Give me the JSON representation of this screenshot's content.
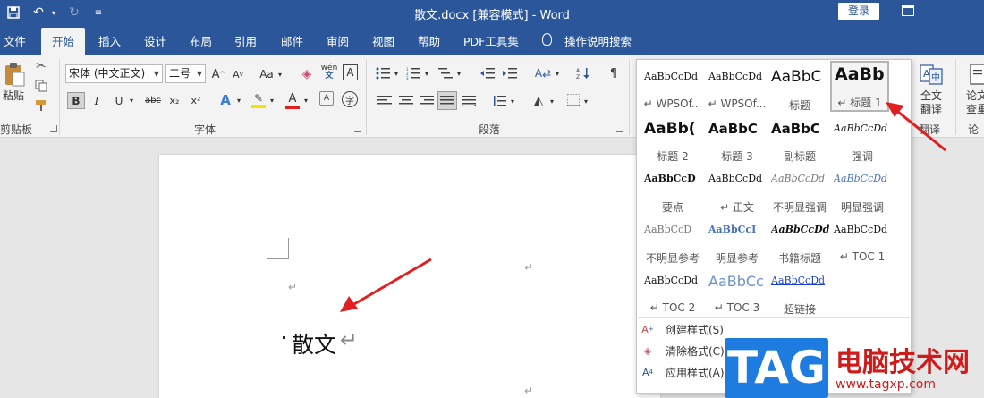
{
  "window": {
    "title": "散文.docx [兼容模式] - Word",
    "login_label": "登录"
  },
  "tabs": [
    "文件",
    "开始",
    "插入",
    "设计",
    "布局",
    "引用",
    "邮件",
    "审阅",
    "视图",
    "帮助",
    "PDF工具集",
    "操作说明搜索"
  ],
  "active_tab": "开始",
  "clipboard": {
    "paste_label": "粘贴",
    "group_label": "剪贴板"
  },
  "font": {
    "family": "宋体 (中文正文)",
    "size": "二号",
    "change_case": "Aa",
    "pinyin": "wén",
    "group_label": "字体",
    "bold": "B",
    "italic": "I",
    "underline": "U",
    "strike": "abc",
    "subscript": "x₂",
    "superscript": "x²",
    "char_border": "A",
    "font_color": "A",
    "font_color_hex": "#e02020",
    "highlight_hex": "#f5e200",
    "enclose": "字"
  },
  "paragraph": {
    "group_label": "段落"
  },
  "right_groups": {
    "translate_line1": "全文",
    "translate_line2": "翻译",
    "translate_group": "翻译",
    "paper_line1": "论文",
    "paper_line2": "查重",
    "paper_group": "论文"
  },
  "document": {
    "heading": "散文",
    "pilcrow": "↵"
  },
  "styles_gallery": {
    "items": [
      {
        "preview": "AaBbCcDd",
        "name": "↵ WPSOf..."
      },
      {
        "preview": "AaBbCcDd",
        "name": "↵ WPSOf..."
      },
      {
        "preview": "AaBbC",
        "name": "标题"
      },
      {
        "preview": "AaBb",
        "name": "↵ 标题 1"
      },
      {
        "preview": "AaBb(",
        "name": "标题 2"
      },
      {
        "preview": "AaBbC",
        "name": "标题 3"
      },
      {
        "preview": "AaBbC",
        "name": "副标题"
      },
      {
        "preview": "AaBbCcDd",
        "name": "强调"
      },
      {
        "preview": "AaBbCcD",
        "name": "要点"
      },
      {
        "preview": "AaBbCcDd",
        "name": "↵ 正文"
      },
      {
        "preview": "AaBbCcDd",
        "name": "不明显强调"
      },
      {
        "preview": "AaBbCcDd",
        "name": "明显强调"
      },
      {
        "preview": "AaBbCcD",
        "name": "不明显参考"
      },
      {
        "preview": "AaBbCcI",
        "name": "明显参考"
      },
      {
        "preview": "AaBbCcDd",
        "name": "书籍标题"
      },
      {
        "preview": "AaBbCcDd",
        "name": "↵ TOC 1"
      },
      {
        "preview": "AaBbCcDd",
        "name": "↵ TOC 2"
      },
      {
        "preview": "AaBbCc",
        "name": "↵ TOC 3"
      },
      {
        "preview": "AaBbCcDd",
        "name": "超链接"
      }
    ],
    "menu": [
      {
        "icon": "create-style-icon",
        "label": "创建样式(S)"
      },
      {
        "icon": "clear-format-icon",
        "label": "清除格式(C)"
      },
      {
        "icon": "apply-style-icon",
        "label": "应用样式(A)..."
      }
    ]
  },
  "watermark": {
    "logo": "TAG",
    "site": "电脑技术网",
    "url": "www.tagxp.com"
  },
  "colors": {
    "title_bar": "#2b579a",
    "ribbon": "#f3f3f3",
    "arrow": "#e02020"
  }
}
